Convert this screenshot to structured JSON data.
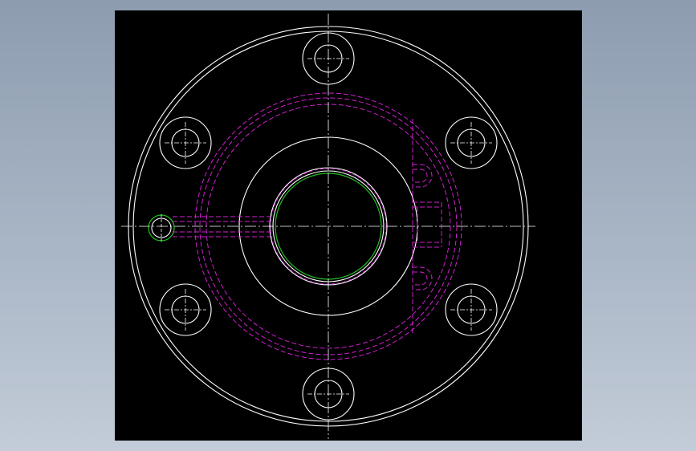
{
  "drawing": {
    "background": "#000000",
    "page_background": "#9aa8ba",
    "colors": {
      "outline": "#ffffff",
      "hidden": "#d020d0",
      "highlight": "#20c020",
      "centerline": "#ffffff"
    },
    "view": "front",
    "bolt_hole_count": 6
  }
}
